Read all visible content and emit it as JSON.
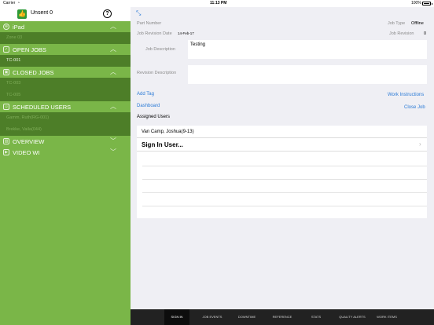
{
  "status_bar": {
    "carrier": "Carrier",
    "time": "11:13 PM",
    "battery": "100%"
  },
  "sidebar": {
    "header": {
      "unsent_label": "Unsent 0",
      "help_glyph": "?"
    },
    "sections": [
      {
        "title": "iPad",
        "icon": "globe-icon",
        "expanded": true,
        "items": [
          "Zone 03"
        ]
      },
      {
        "title": "OPEN JOBS",
        "icon": "open-jobs-icon",
        "expanded": true,
        "items": [
          "TC-001"
        ]
      },
      {
        "title": "CLOSED JOBS",
        "icon": "closed-jobs-icon",
        "expanded": true,
        "items": [
          "TC-003",
          "TC-005"
        ]
      },
      {
        "title": "SCHEDULED USERS",
        "icon": "users-icon",
        "expanded": true,
        "items": [
          "Gamm, Ruth(RG-001)",
          "Brekke, Vaila(044)"
        ]
      },
      {
        "title": "OVERVIEW",
        "icon": "overview-icon",
        "expanded": false,
        "items": []
      },
      {
        "title": "VIDEO WI",
        "icon": "video-icon",
        "expanded": false,
        "items": []
      }
    ]
  },
  "main": {
    "part_number_label": "Part Number",
    "part_number_value": "",
    "job_type_label": "Job Type",
    "job_type_value": "Offline",
    "job_revision_date_label": "Job Revision Date",
    "job_revision_date_value": "14-Feb-17",
    "job_revision_label": "Job Revision",
    "job_revision_value": "0",
    "job_description_label": "Job Description",
    "job_description_value": "Testing",
    "revision_description_label": "Revision Description",
    "revision_description_value": "",
    "add_tag": "Add Tag",
    "work_instructions": "Work Instructions",
    "dashboard": "Dashboard",
    "close_job": "Close Job",
    "assigned_users_label": "Assigned Users",
    "assigned_users": [
      "Van Camp, Joshua(9-13)"
    ],
    "sign_in_user": "Sign In User..."
  },
  "tabbar": {
    "tabs": [
      "SIGN IN",
      "JOB EVENTS",
      "DOWNTIME",
      "REFERENCE",
      "STATS",
      "QUALITY ALERTS",
      "WORK ITEMS"
    ],
    "active_index": 0
  },
  "colors": {
    "sidebar_green": "#7ab648",
    "sidebar_dark_green": "#4d7e28",
    "link_blue": "#2a7ad6",
    "tabbar_bg": "#222222"
  }
}
